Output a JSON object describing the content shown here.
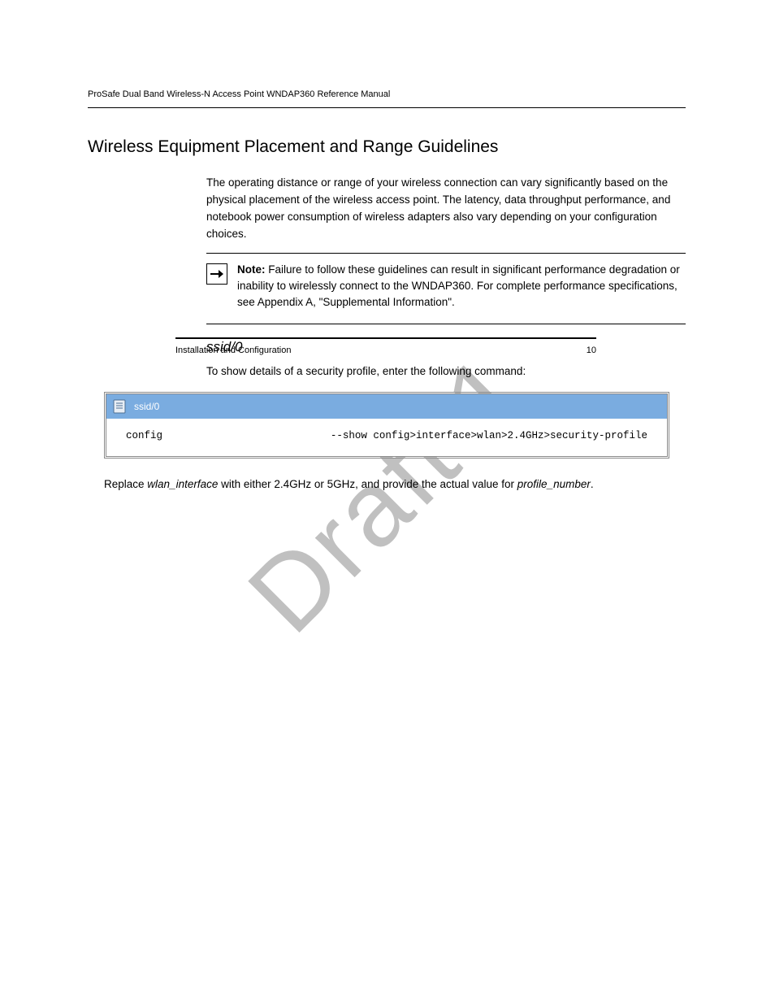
{
  "header": {
    "title": "ProSafe Dual Band Wireless-N Access Point WNDAP360 Reference Manual"
  },
  "watermark": "Draft 1",
  "section": {
    "title": "Wireless Equipment Placement and Range Guidelines",
    "p1": "The operating distance or range of your wireless connection can vary significantly based on the physical placement of the wireless access point. The latency, data throughput performance, and notebook power consumption of wireless adapters also vary depending on your configuration choices.",
    "note_label": "Note:",
    "note_text": "Failure to follow these guidelines can result in significant performance degradation or inability to wirelessly connect to the WNDAP360. For complete performance specifications, see ",
    "note_link": "Appendix A, \"Supplemental Information\".",
    "sub_heading": "ssid/0",
    "p2": "To show details of a security profile, enter the following command:"
  },
  "example": {
    "header_label": "ssid/0",
    "left": "config",
    "right": "--show config>interface>wlan>2.4GHz>security-profile"
  },
  "variable_block": {
    "lead": "Replace ",
    "var1": "wlan_interface",
    "mid1": " with either 2.4GHz or 5GHz, and provide the actual value for ",
    "var2": "profile_number",
    "tail": "."
  },
  "footer": {
    "left": "Installation and Configuration",
    "page": "10"
  }
}
